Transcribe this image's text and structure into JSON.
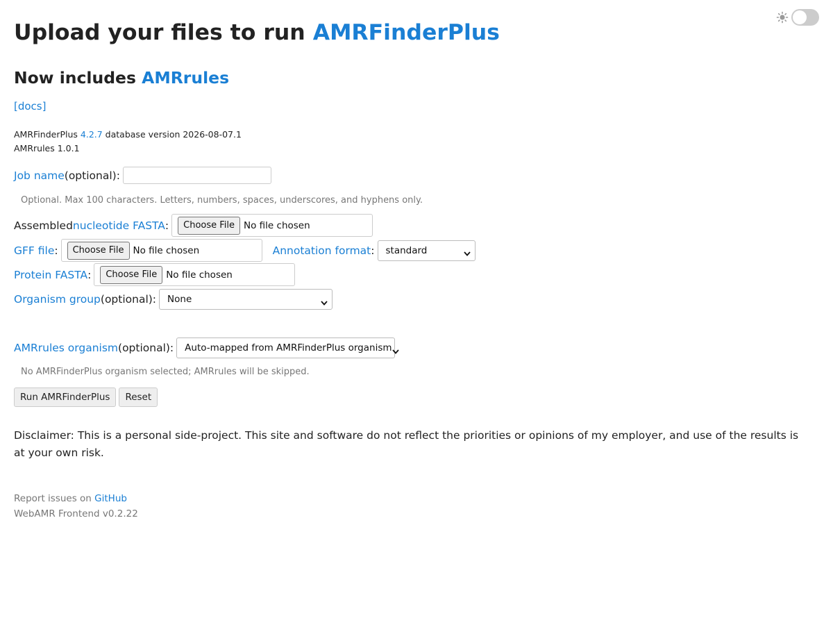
{
  "title": {
    "prefix": "Upload your files to run ",
    "accent": "AMRFinderPlus"
  },
  "subtitle": {
    "prefix": "Now includes ",
    "accent": "AMRrules"
  },
  "docs_link": "[docs]",
  "versions": {
    "amrfinder_label": "AMRFinderPlus ",
    "amrfinder_version": "4.2.7",
    "db_text": " database version 2026-08-07.1",
    "amrrules": "AMRrules 1.0.1"
  },
  "job_name": {
    "link": "Job name",
    "suffix": " (optional):",
    "value": "",
    "help": "Optional. Max 100 characters. Letters, numbers, spaces, underscores, and hyphens only."
  },
  "nucleotide": {
    "prefix": "Assembled ",
    "link": "nucleotide FASTA",
    "suffix": ":"
  },
  "gff": {
    "link": "GFF file",
    "suffix": ":"
  },
  "annotation": {
    "link": "Annotation format",
    "suffix": ":",
    "selected": "standard"
  },
  "protein": {
    "link": "Protein FASTA",
    "suffix": ":"
  },
  "file_input": {
    "button": "Choose File",
    "status": "No file chosen"
  },
  "organism": {
    "link": "Organism group",
    "suffix": " (optional):",
    "selected": "None"
  },
  "amrrules_org": {
    "link": "AMRrules organism",
    "suffix": " (optional):",
    "selected": "Auto-mapped from AMRFinderPlus organism",
    "help": "No AMRFinderPlus organism selected; AMRrules will be skipped."
  },
  "buttons": {
    "run": "Run AMRFinderPlus",
    "reset": "Reset"
  },
  "disclaimer": "Disclaimer: This is a personal side-project. This site and software do not reflect the priorities or opinions of my employer, and use of the results is at your own risk.",
  "footer": {
    "report_prefix": "Report issues on ",
    "github": "GitHub",
    "frontend_version": "WebAMR Frontend v0.2.22"
  },
  "theme_toggle": {
    "icon": "sun-icon",
    "state": "off"
  },
  "colors": {
    "accent": "#1a7fd4",
    "text": "#222222",
    "muted": "#777777"
  }
}
